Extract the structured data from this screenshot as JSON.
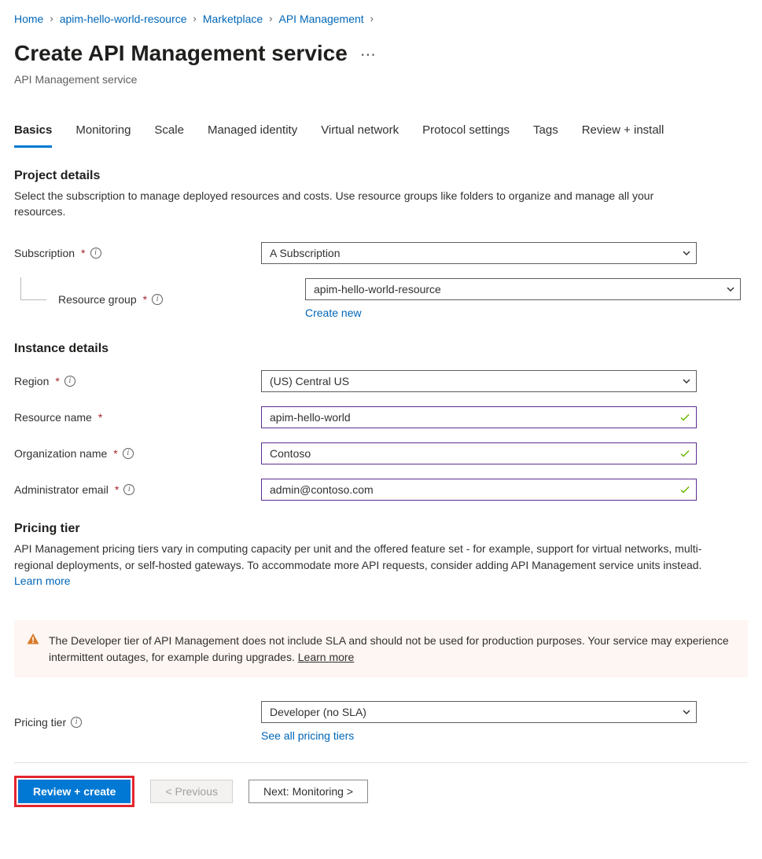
{
  "breadcrumb": {
    "items": [
      "Home",
      "apim-hello-world-resource",
      "Marketplace",
      "API Management"
    ]
  },
  "header": {
    "title": "Create API Management service",
    "subtitle": "API Management service"
  },
  "tabs": {
    "items": [
      "Basics",
      "Monitoring",
      "Scale",
      "Managed identity",
      "Virtual network",
      "Protocol settings",
      "Tags",
      "Review + install"
    ],
    "activeIndex": 0
  },
  "sections": {
    "project": {
      "title": "Project details",
      "desc": "Select the subscription to manage deployed resources and costs. Use resource groups like folders to organize and manage all your resources.",
      "subscription": {
        "label": "Subscription",
        "value": "A Subscription"
      },
      "resourceGroup": {
        "label": "Resource group",
        "value": "apim-hello-world-resource",
        "createNew": "Create new"
      }
    },
    "instance": {
      "title": "Instance details",
      "region": {
        "label": "Region",
        "value": "(US) Central US"
      },
      "resourceName": {
        "label": "Resource name",
        "value": "apim-hello-world"
      },
      "orgName": {
        "label": "Organization name",
        "value": "Contoso"
      },
      "adminEmail": {
        "label": "Administrator email",
        "value": "admin@contoso.com"
      }
    },
    "pricing": {
      "title": "Pricing tier",
      "desc": "API Management pricing tiers vary in computing capacity per unit and the offered feature set - for example, support for virtual networks, multi-regional deployments, or self-hosted gateways. To accommodate more API requests, consider adding API Management service units instead.",
      "learnMore": "Learn more",
      "warning": "The Developer tier of API Management does not include SLA and should not be used for production purposes. Your service may experience intermittent outages, for example during upgrades.",
      "warningLearnMore": "Learn more",
      "tier": {
        "label": "Pricing tier",
        "value": "Developer (no SLA)",
        "seeAll": "See all pricing tiers"
      }
    }
  },
  "footer": {
    "review": "Review + create",
    "previous": "< Previous",
    "next": "Next: Monitoring >"
  }
}
